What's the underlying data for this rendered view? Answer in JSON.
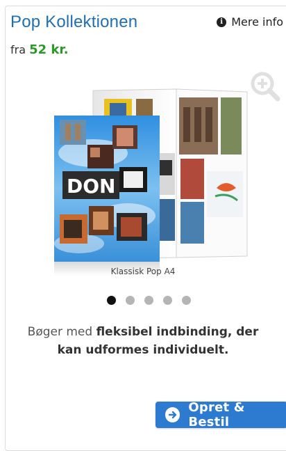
{
  "product": {
    "title": "Pop Kollektionen",
    "more_info_label": "Mere info",
    "price_prefix": "fra",
    "price_amount": "52 kr.",
    "image_caption": "Klassisk Pop A4",
    "description_plain": "Bøger med ",
    "description_bold": "fleksibel indbinding, der kan udformes individuelt.",
    "cta_label": "Opret & Bestil"
  },
  "book_cover_text": "DON",
  "carousel": {
    "count": 5,
    "active_index": 0
  },
  "colors": {
    "title": "#1f6fb8",
    "price": "#2a9b2a",
    "cta_background": "#2c7bd1",
    "active_dot": "#111111",
    "inactive_dot": "#b5b5b5"
  },
  "icons": {
    "more_info": "info-circle-icon",
    "zoom": "zoom-in-icon",
    "cta": "arrow-right-circle-icon"
  }
}
